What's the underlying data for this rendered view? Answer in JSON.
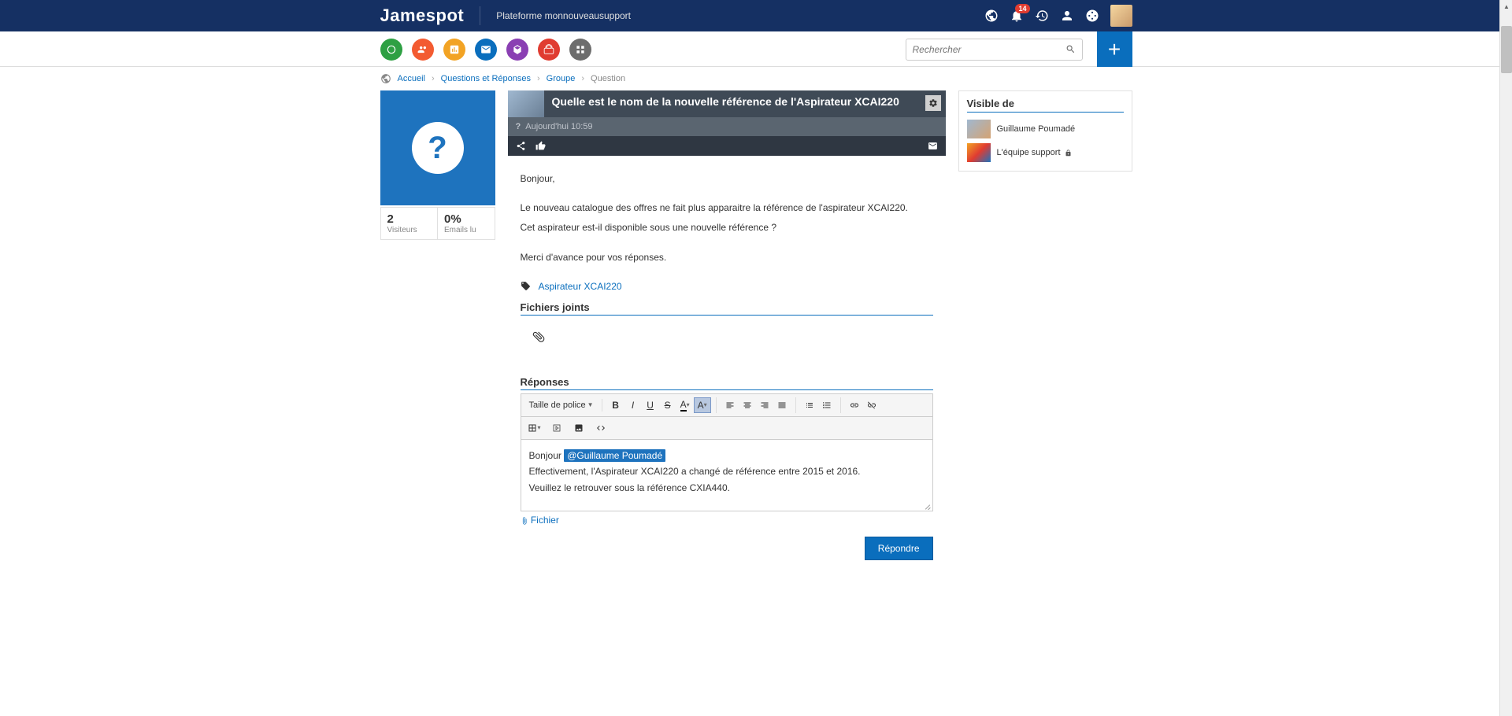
{
  "header": {
    "logo": "Jamespot",
    "platform_label": "Plateforme monnouveausupport",
    "notification_count": "14"
  },
  "search": {
    "placeholder": "Rechercher"
  },
  "breadcrumb": {
    "home": "Accueil",
    "level2": "Questions et Réponses",
    "level3": "Groupe",
    "current": "Question"
  },
  "stats": {
    "visitors_count": "2",
    "visitors_label": "Visiteurs",
    "emails_pct": "0%",
    "emails_label": "Emails lu"
  },
  "question": {
    "title": "Quelle est le nom de la nouvelle référence de l'Aspirateur XCAI220",
    "date": "Aujourd'hui 10:59",
    "greeting": "Bonjour,",
    "body_l1": "Le nouveau catalogue des offres ne fait plus apparaitre la référence de l'aspirateur XCAI220.",
    "body_l2": "Cet aspirateur est-il disponible sous une nouvelle référence ?",
    "closing": "Merci d'avance pour vos réponses.",
    "tag": "Aspirateur XCAI220"
  },
  "sections": {
    "attachments": "Fichiers joints",
    "responses": "Réponses"
  },
  "editor": {
    "font_size_label": "Taille de police",
    "greeting": "Bonjour ",
    "mention": "@Guillaume Poumadé",
    "line2": "Effectivement, l'Aspirateur XCAI220 a changé de référence entre 2015 et 2016.",
    "line3": "Veuillez le retrouver sous la référence CXIA440.",
    "file_link": "Fichier",
    "submit": "Répondre"
  },
  "sidebar": {
    "visible_title": "Visible de",
    "user1": "Guillaume Poumadé",
    "user2": "L'équipe support"
  }
}
